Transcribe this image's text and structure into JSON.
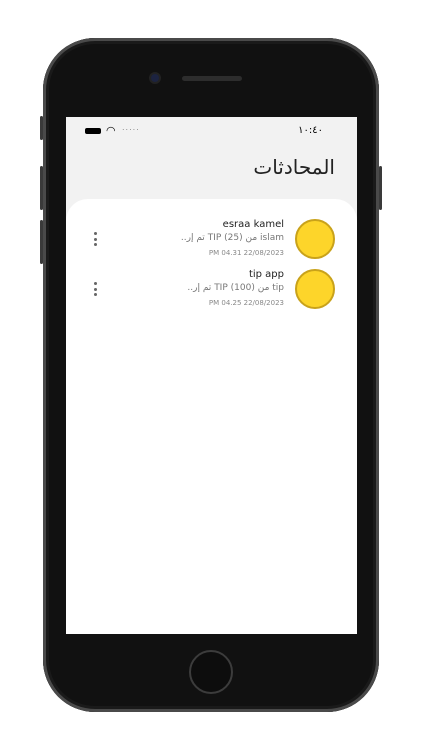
{
  "status": {
    "time": "١٠:٤٠",
    "signal_dots": "....."
  },
  "header": {
    "title": "المحادثات"
  },
  "conversations": [
    {
      "name": "esraa kamel",
      "message": "islam من (25) TIP تم إر..",
      "timestamp": "PM 04.31 22/08/2023"
    },
    {
      "name": "tip app",
      "message": "tip من (100) TIP تم إر..",
      "timestamp": "PM 04.25 22/08/2023"
    }
  ],
  "colors": {
    "avatar_fill": "#fdd52a",
    "avatar_border": "#c9a21a",
    "header_bg": "#f2f2f2"
  },
  "icons": {
    "battery": "battery-icon",
    "wifi": "wifi-icon",
    "more": "more-vertical-icon"
  }
}
